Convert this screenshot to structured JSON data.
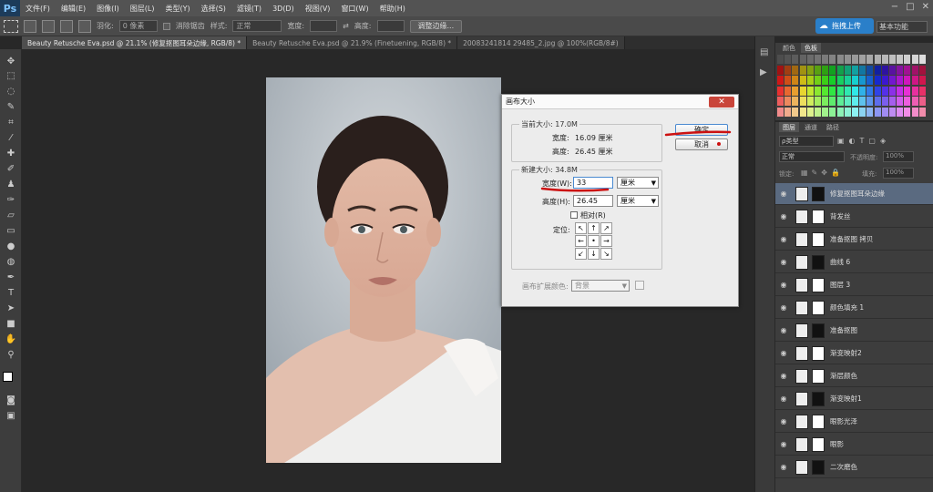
{
  "menu": [
    "文件(F)",
    "编辑(E)",
    "图像(I)",
    "图层(L)",
    "类型(Y)",
    "选择(S)",
    "滤镜(T)",
    "3D(D)",
    "视图(V)",
    "窗口(W)",
    "帮助(H)"
  ],
  "options": {
    "feather_label": "羽化:",
    "feather_value": "0 像素",
    "antialias_label": "消除锯齿",
    "style_label": "样式:",
    "style_value": "正常",
    "width_label": "宽度:",
    "height_label": "高度:",
    "refine_button": "调整边缘..."
  },
  "upload_button": "拖拽上传",
  "workspace": "基本功能",
  "tabs": [
    "Beauty Retusche Eva.psd @ 21.1% (修复抠图耳朵边缘, RGB/8) *",
    "Beauty Retusche Eva.psd @ 21.9% (Finetuening, RGB/8) *",
    "20083241814 29485_2.jpg @ 100%(RGB/8#)"
  ],
  "dialog": {
    "title": "画布大小",
    "current_legend": "当前大小: 17.0M",
    "cur_width_label": "宽度:",
    "cur_width_value": "16.09 厘米",
    "cur_height_label": "高度:",
    "cur_height_value": "26.45 厘米",
    "new_legend": "新建大小: 34.8M",
    "new_width_label": "宽度(W):",
    "new_width_value": "33",
    "new_width_unit": "厘米",
    "new_height_label": "高度(H):",
    "new_height_value": "26.45",
    "new_height_unit": "厘米",
    "relative_label": "相对(R)",
    "anchor_label": "定位:",
    "anchors": [
      "↖",
      "↑",
      "↗",
      "←",
      "•",
      "→",
      "↙",
      "↓",
      "↘"
    ],
    "ext_color_label": "画布扩展颜色:",
    "ext_color_value": "背景",
    "ok": "确定",
    "cancel": "取消"
  },
  "swatch_tabs": [
    "颜色",
    "色板"
  ],
  "layer_tabs": [
    "图层",
    "通道",
    "路径"
  ],
  "layer_controls": {
    "filter": "ρ类型",
    "blend": "正常",
    "opacity_label": "不透明度:",
    "opacity_value": "100%",
    "lock_label": "锁定:",
    "fill_label": "填充:",
    "fill_value": "100%"
  },
  "layers": [
    {
      "name": "修复抠图耳朵边缘",
      "selected": true
    },
    {
      "name": "背发丝",
      "selected": false
    },
    {
      "name": "准备抠图 拷贝",
      "selected": false
    },
    {
      "name": "曲线 6",
      "selected": false
    },
    {
      "name": "图层 3",
      "selected": false
    },
    {
      "name": "颜色填充 1",
      "selected": false
    },
    {
      "name": "准备抠图",
      "selected": false
    },
    {
      "name": "渐变映射2",
      "selected": false
    },
    {
      "name": "渐层颜色",
      "selected": false
    },
    {
      "name": "渐变映射1",
      "selected": false
    },
    {
      "name": "眼影光泽",
      "selected": false
    },
    {
      "name": "眼影",
      "selected": false
    },
    {
      "name": "二次磨色",
      "selected": false
    }
  ],
  "colors": {
    "accent": "#2a7fc9",
    "dialog_bg": "#ececec",
    "close": "#c9453a",
    "annotation": "#cc1111"
  }
}
